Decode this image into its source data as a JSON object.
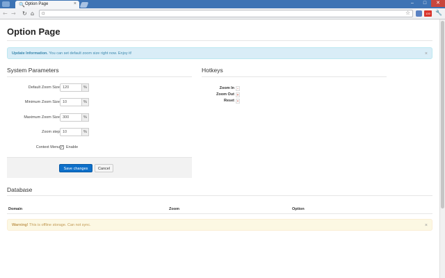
{
  "browser": {
    "tab_title": "Option Page",
    "tab_favicon": "zoom-icon",
    "tab_close": "×",
    "url": "",
    "ext_badge_text": "100"
  },
  "icons": {
    "back": "←",
    "forward": "→",
    "reload": "↻",
    "home": "⌂",
    "star": "☆",
    "wrench": "🔧",
    "minimize": "–",
    "maximize": "□",
    "close": "✕",
    "alert_close": "×"
  },
  "page": {
    "title": "Option Page"
  },
  "info_alert": {
    "strong": "Update Information.",
    "text": " You can set default zoom size right now. Enjoy it!"
  },
  "system": {
    "title": "System Parameters",
    "fields": [
      {
        "label": "Default Zoom Size",
        "value": "120",
        "unit": "%"
      },
      {
        "label": "Minimum Zoom Size",
        "value": "10",
        "unit": "%"
      },
      {
        "label": "Maximum Zoom Size",
        "value": "300",
        "unit": "%"
      },
      {
        "label": "Zoom step",
        "value": "10",
        "unit": "%"
      }
    ],
    "context_menu": {
      "label": "Context Menu",
      "checkbox_label": "Enable",
      "checked_mark": "✓"
    },
    "save_label": "Save changes",
    "cancel_label": "Cancel"
  },
  "hotkeys": {
    "title": "Hotkeys",
    "items": [
      {
        "label": "Zoom In",
        "key": "-"
      },
      {
        "label": "Zoom Out",
        "key": "+"
      },
      {
        "label": "Reset",
        "key": "•"
      }
    ]
  },
  "database": {
    "title": "Database",
    "columns": [
      "Domain",
      "Zoom",
      "Option"
    ]
  },
  "warning_alert": {
    "strong": "Warning!",
    "text": " This is offline storage. Can not sync."
  },
  "colors": {
    "primary": "#0d6fc9",
    "info_bg": "#d9edf7",
    "warning_bg": "#fcf8e3",
    "tabstrip": "#3d73b4"
  }
}
